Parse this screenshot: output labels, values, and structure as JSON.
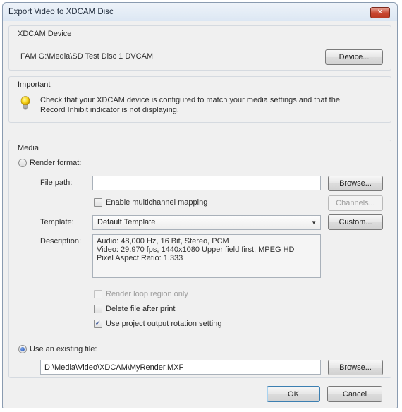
{
  "window": {
    "title": "Export Video to XDCAM Disc",
    "close_label": "✕"
  },
  "xdcam_device": {
    "label": "XDCAM Device",
    "device_path": "FAM G:\\Media\\SD Test Disc 1 DVCAM",
    "device_button": "Device..."
  },
  "important": {
    "label": "Important",
    "message_line1": "Check that your XDCAM device is configured to match your media settings and that the",
    "message_line2": "Record Inhibit indicator is not displaying."
  },
  "media": {
    "label": "Media",
    "render_format_label": "Render format:",
    "render_format_selected": false,
    "file_path_label": "File path:",
    "file_path_value": "",
    "browse_button": "Browse...",
    "multichannel_label": "Enable multichannel mapping",
    "multichannel_checked": false,
    "channels_button": "Channels...",
    "template_label": "Template:",
    "template_value": "Default Template",
    "custom_button": "Custom...",
    "description_label": "Description:",
    "description_lines": [
      "Audio: 48,000 Hz, 16 Bit, Stereo, PCM",
      "Video: 29.970 fps, 1440x1080 Upper field first, MPEG HD",
      "Pixel Aspect Ratio: 1.333"
    ],
    "render_loop_label": "Render loop region only",
    "render_loop_checked": false,
    "delete_file_label": "Delete file after print",
    "delete_file_checked": false,
    "rotation_label": "Use project output rotation setting",
    "rotation_checked": true,
    "existing_file_label": "Use an existing file:",
    "existing_file_selected": true,
    "existing_file_path": "D:\\Media\\Video\\XDCAM\\MyRender.MXF",
    "existing_browse_button": "Browse..."
  },
  "footer": {
    "ok_button": "OK",
    "cancel_button": "Cancel"
  }
}
